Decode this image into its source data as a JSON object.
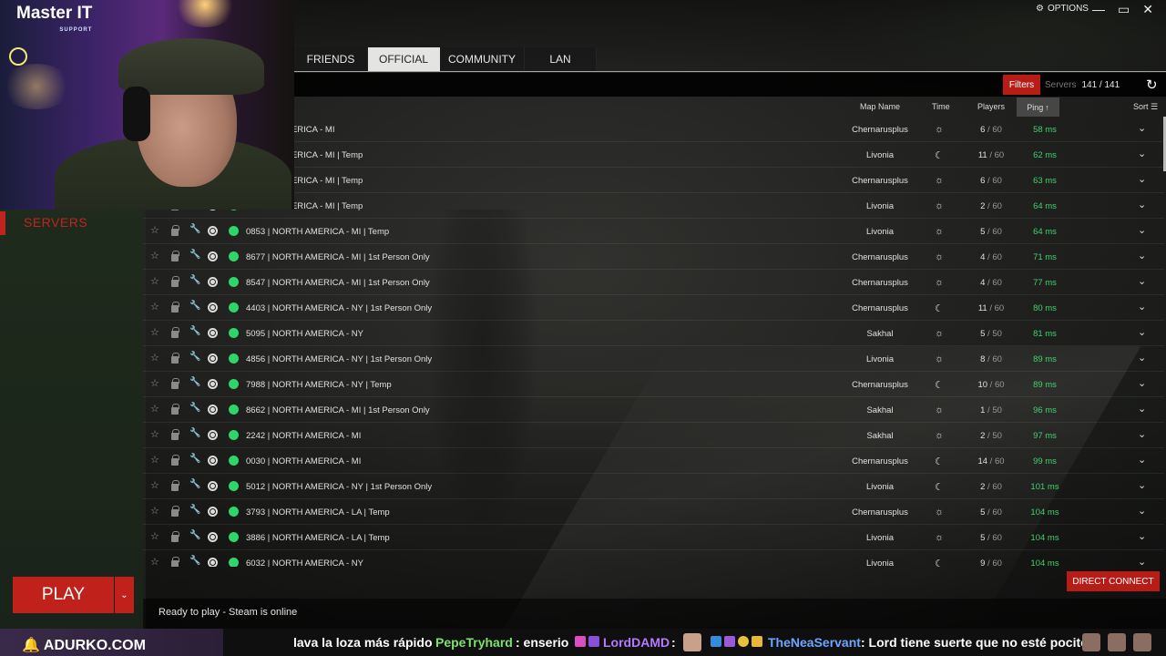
{
  "window": {
    "options_label": "OPTIONS",
    "minimize": "—",
    "maximize": "▭",
    "close": "✕"
  },
  "overlay": {
    "logo_text": "Master IT",
    "logo_sub": "SUPPORT"
  },
  "sidebar": {
    "servers_label": "SERVERS"
  },
  "tabs": [
    {
      "label": "FRIENDS",
      "active": false
    },
    {
      "label": "OFFICIAL",
      "active": true
    },
    {
      "label": "COMMUNITY",
      "active": false
    },
    {
      "label": "LAN",
      "active": false
    }
  ],
  "filter_bar": {
    "filters_label": "Filters",
    "servers_label": "Servers",
    "servers_count": "141 / 141",
    "refresh_icon": "↻"
  },
  "columns": {
    "map": "Map Name",
    "time": "Time",
    "players": "Players",
    "ping": "Ping",
    "sort": "Sort"
  },
  "rows": [
    {
      "name": "NORTH AMERICA - MI",
      "map": "Chernarusplus",
      "time": "day",
      "players": "6",
      "max": "60",
      "ping": "58 ms"
    },
    {
      "name": "NORTH AMERICA - MI | Temp",
      "map": "Livonia",
      "time": "night",
      "players": "11",
      "max": "60",
      "ping": "62 ms"
    },
    {
      "name": "NORTH AMERICA - MI | Temp",
      "map": "Chernarusplus",
      "time": "day",
      "players": "6",
      "max": "60",
      "ping": "63 ms"
    },
    {
      "name": "NORTH AMERICA - MI | Temp",
      "map": "Livonia",
      "time": "day",
      "players": "2",
      "max": "60",
      "ping": "64 ms"
    },
    {
      "name": "0853 | NORTH AMERICA - MI | Temp",
      "map": "Livonia",
      "time": "day",
      "players": "5",
      "max": "60",
      "ping": "64 ms"
    },
    {
      "name": "8677 | NORTH AMERICA - MI | 1st Person Only",
      "map": "Chernarusplus",
      "time": "day",
      "players": "4",
      "max": "60",
      "ping": "71 ms"
    },
    {
      "name": "8547 | NORTH AMERICA - MI | 1st Person Only",
      "map": "Chernarusplus",
      "time": "day",
      "players": "4",
      "max": "60",
      "ping": "77 ms"
    },
    {
      "name": "4403 | NORTH AMERICA - NY | 1st Person Only",
      "map": "Chernarusplus",
      "time": "night",
      "players": "11",
      "max": "60",
      "ping": "80 ms"
    },
    {
      "name": "5095 | NORTH AMERICA - NY",
      "map": "Sakhal",
      "time": "day",
      "players": "5",
      "max": "50",
      "ping": "81 ms"
    },
    {
      "name": "4856 | NORTH AMERICA - NY | 1st Person Only",
      "map": "Livonia",
      "time": "day",
      "players": "8",
      "max": "60",
      "ping": "89 ms"
    },
    {
      "name": "7988 | NORTH AMERICA - NY | Temp",
      "map": "Chernarusplus",
      "time": "night",
      "players": "10",
      "max": "60",
      "ping": "89 ms"
    },
    {
      "name": "8662 | NORTH AMERICA - MI | 1st Person Only",
      "map": "Sakhal",
      "time": "day",
      "players": "1",
      "max": "50",
      "ping": "96 ms"
    },
    {
      "name": "2242 | NORTH AMERICA - MI",
      "map": "Sakhal",
      "time": "day",
      "players": "2",
      "max": "50",
      "ping": "97 ms"
    },
    {
      "name": "0030 | NORTH AMERICA - MI",
      "map": "Chernarusplus",
      "time": "night",
      "players": "14",
      "max": "60",
      "ping": "99 ms"
    },
    {
      "name": "5012 | NORTH AMERICA - NY | 1st Person Only",
      "map": "Livonia",
      "time": "night",
      "players": "2",
      "max": "60",
      "ping": "101 ms"
    },
    {
      "name": "3793 | NORTH AMERICA - LA | Temp",
      "map": "Chernarusplus",
      "time": "day",
      "players": "5",
      "max": "60",
      "ping": "104 ms"
    },
    {
      "name": "3886 | NORTH AMERICA - LA | Temp",
      "map": "Livonia",
      "time": "day",
      "players": "5",
      "max": "60",
      "ping": "104 ms"
    },
    {
      "name": "6032 | NORTH AMERICA - NY",
      "map": "Livonia",
      "time": "night",
      "players": "9",
      "max": "60",
      "ping": "104 ms"
    }
  ],
  "bottom": {
    "play_label": "PLAY",
    "play_dropdown": "⌄",
    "direct_connect_label": "DIRECT CONNECT",
    "status_text": "Ready to play - Steam is online"
  },
  "ticker": {
    "brand": "ADURKO.COM",
    "msg1_text": "lava la loza más rápido",
    "msg2_user": "PepeTryhard",
    "msg2_text": ": enserio",
    "msg3_user": "LordDAMD",
    "msg3_text": ":",
    "msg4_user": "TheNeaServant",
    "msg4_text": ": Lord tiene suerte que no esté pocito"
  },
  "colors": {
    "accent_red": "#c0211b",
    "ping_green": "#3fd36c",
    "status_green": "#2fd46a"
  }
}
